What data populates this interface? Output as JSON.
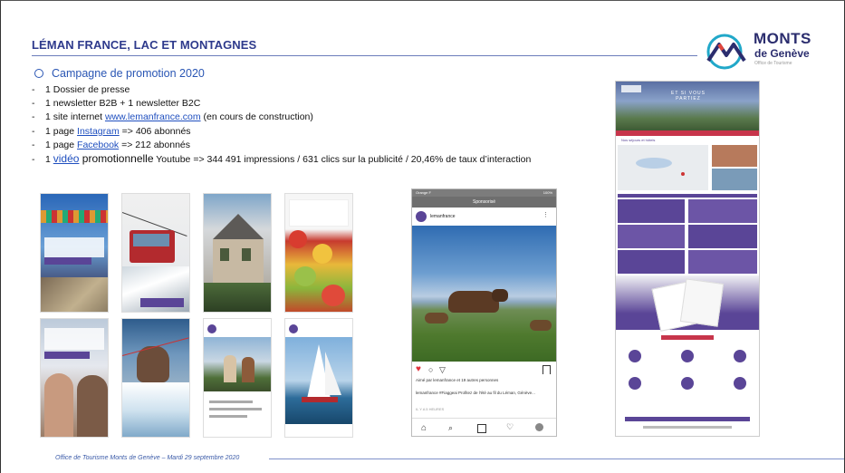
{
  "slide": {
    "title": "LÉMAN FRANCE, LAC ET MONTAGNES",
    "section_heading": "Campagne de promotion 2020",
    "items": [
      {
        "prefix": "1 Dossier de presse",
        "link": "",
        "suffix": ""
      },
      {
        "prefix": "1 newsletter B2B + 1 newsletter B2C",
        "link": "",
        "suffix": ""
      },
      {
        "prefix": "1 site internet ",
        "link": "www.lemanfrance.com",
        "suffix": " (en cours de construction)"
      },
      {
        "prefix": "1 page ",
        "link": "Instagram",
        "suffix": " => 406 abonnés"
      },
      {
        "prefix": "1 page ",
        "link": "Facebook",
        "suffix": " => 212 abonnés"
      },
      {
        "prefix": "1 ",
        "link": "vidéo",
        "word": " promotionnelle",
        "suffix": " Youtube => 344 491 impressions / 631 clics sur la publicité / 20,46% de taux d’interaction"
      }
    ],
    "footer": "Office de Tourisme Monts de Genève – Mardi 29 septembre 2020"
  },
  "logo": {
    "line1": "MONTS",
    "line2": "de Genève",
    "line3": "Office de Tourisme",
    "colors": {
      "navy": "#2b2d6e",
      "teal": "#21a8c9",
      "red": "#e2453c"
    }
  },
  "instagram_post": {
    "status_left": "Orange F",
    "status_right": "100%",
    "app_title": "Sponsorisé",
    "account": "lemanfrance",
    "likes": "Aimé par lemanfrance et 19 autres personnes",
    "caption": "lemanfrance #Fiaggeai Profitez de l'été au fil du Léman, Génève...",
    "time": "IL Y A 5 HEURES"
  },
  "website_mockup": {
    "hero_text": "ET SI VOUS PARTIEZ",
    "section_label": "Nos séjours et hôtels"
  },
  "colors": {
    "title": "#2e3a8c",
    "bullet": "#2a56b4",
    "purple": "#5a4597",
    "link": "#1f4fbf"
  }
}
